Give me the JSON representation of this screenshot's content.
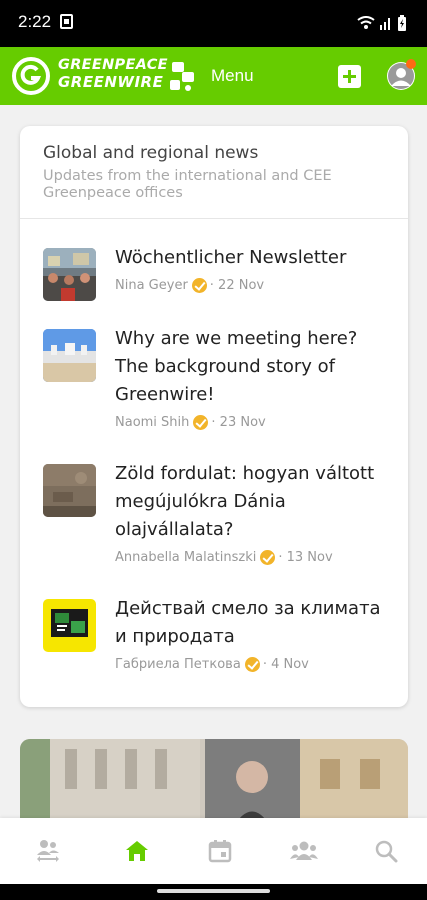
{
  "status_bar": {
    "time": "2:22"
  },
  "app_bar": {
    "brand_top": "GREENPEACE",
    "brand_bottom": "GREENWIRE",
    "menu_label": "Menu",
    "accent_color": "#66cc00",
    "notification_color": "#ff6a13"
  },
  "card": {
    "title": "Global and regional news",
    "subtitle": "Updates from the international and CEE Greenpeace offices",
    "items": [
      {
        "title": "Wöchentlicher Newsletter",
        "author": "Nina Geyer",
        "date": "· 22 Nov",
        "thumb_icon": "protest-photo"
      },
      {
        "title": "Why are we meeting here? The background story of Greenwire!",
        "author": "Naomi Shih",
        "date": "· 23 Nov",
        "thumb_icon": "building-photo"
      },
      {
        "title": "Zöld fordulat: hogyan váltott megújulókra Dánia olajvállalata?",
        "author": "Annabella Malatinszki",
        "date": "· 13 Nov",
        "thumb_icon": "aerial-photo"
      },
      {
        "title": "Действай смело за климата и природата",
        "author": "Габриела Петкова",
        "date": "· 4 Nov",
        "thumb_icon": "yellow-graphic"
      }
    ]
  },
  "bottom_nav": {
    "items": [
      {
        "icon": "people-exchange-icon",
        "active": false
      },
      {
        "icon": "home-icon",
        "active": true
      },
      {
        "icon": "calendar-icon",
        "active": false
      },
      {
        "icon": "groups-icon",
        "active": false
      },
      {
        "icon": "search-icon",
        "active": false
      }
    ]
  }
}
